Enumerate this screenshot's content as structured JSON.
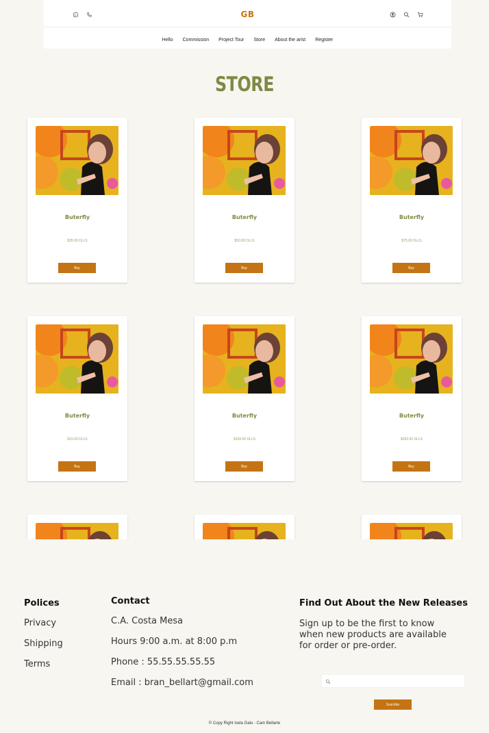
{
  "header": {
    "logo": "GB",
    "left_icons": [
      "whatsapp-icon",
      "phone-icon"
    ],
    "right_icons": [
      "user-icon",
      "search-icon",
      "cart-icon"
    ],
    "nav": [
      {
        "label": "Hello"
      },
      {
        "label": "Commission"
      },
      {
        "label": "Project Tour"
      },
      {
        "label": "Store"
      },
      {
        "label": "About the arist"
      },
      {
        "label": "Register"
      }
    ]
  },
  "store": {
    "title": "STORE",
    "buy_label": "Buy",
    "products": [
      {
        "name": "Buterfly",
        "price": "$35.00 DLLS"
      },
      {
        "name": "Buterfly",
        "price": "$50.00 DLLS"
      },
      {
        "name": "Buterfly",
        "price": "$75.00 DLLS"
      },
      {
        "name": "Buterfly",
        "price": "$15.00 DLLS"
      },
      {
        "name": "Buterfly",
        "price": "$100.00 DLLS"
      },
      {
        "name": "Buterfly",
        "price": "$250.00 DLLS"
      },
      {
        "name": "",
        "price": ""
      },
      {
        "name": "",
        "price": ""
      },
      {
        "name": "",
        "price": ""
      }
    ]
  },
  "footer": {
    "policies": {
      "heading": "Polices",
      "items": [
        "Privacy",
        "Shipping",
        "Terms"
      ]
    },
    "contact": {
      "heading": "Contact",
      "lines": [
        "C.A. Costa Mesa",
        "Hours 9:00 a.m. at 8:00 p.m",
        "Phone : 55.55.55.55.55",
        "Email : bran_bellart@gmail.com"
      ]
    },
    "newsletter": {
      "heading": "Find Out About the New Releases",
      "text_lines": [
        "Sign up to be the first to know",
        "when new products are available",
        "for order or pre-order."
      ],
      "input_placeholder": "",
      "button_label": "Suscribe"
    },
    "copyright": "© Copy Right Isela Galo - Cam Bellarte"
  },
  "colors": {
    "accent": "#c47414",
    "title_green": "#7e8a43",
    "background": "#f8f6f1"
  }
}
